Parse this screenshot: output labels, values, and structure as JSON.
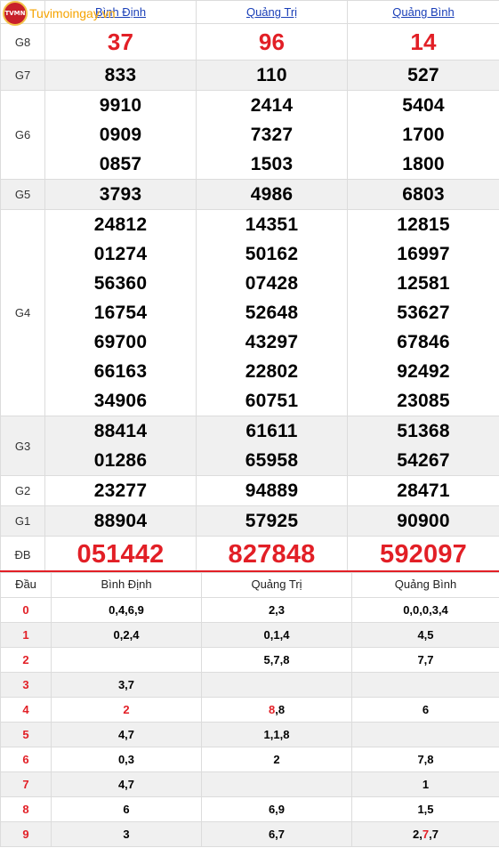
{
  "logo": {
    "text": "Tuvimoingay.vn",
    "badge": "TVMN"
  },
  "provinces": [
    "Bình Định",
    "Quảng Trị",
    "Quảng Bình"
  ],
  "prizes": [
    {
      "label": "G8",
      "values": [
        [
          "37"
        ],
        [
          "96"
        ],
        [
          "14"
        ]
      ]
    },
    {
      "label": "G7",
      "values": [
        [
          "833"
        ],
        [
          "110"
        ],
        [
          "527"
        ]
      ]
    },
    {
      "label": "G6",
      "values": [
        [
          "9910",
          "0909",
          "0857"
        ],
        [
          "2414",
          "7327",
          "1503"
        ],
        [
          "5404",
          "1700",
          "1800"
        ]
      ]
    },
    {
      "label": "G5",
      "values": [
        [
          "3793"
        ],
        [
          "4986"
        ],
        [
          "6803"
        ]
      ]
    },
    {
      "label": "G4",
      "values": [
        [
          "24812",
          "01274",
          "56360",
          "16754",
          "69700",
          "66163",
          "34906"
        ],
        [
          "14351",
          "50162",
          "07428",
          "52648",
          "43297",
          "22802",
          "60751"
        ],
        [
          "12815",
          "16997",
          "12581",
          "53627",
          "67846",
          "92492",
          "23085"
        ]
      ]
    },
    {
      "label": "G3",
      "values": [
        [
          "88414",
          "01286"
        ],
        [
          "61611",
          "65958"
        ],
        [
          "51368",
          "54267"
        ]
      ]
    },
    {
      "label": "G2",
      "values": [
        [
          "23277"
        ],
        [
          "94889"
        ],
        [
          "28471"
        ]
      ]
    },
    {
      "label": "G1",
      "values": [
        [
          "88904"
        ],
        [
          "57925"
        ],
        [
          "90900"
        ]
      ]
    },
    {
      "label": "ĐB",
      "values": [
        [
          "051442"
        ],
        [
          "827848"
        ],
        [
          "592097"
        ]
      ]
    }
  ],
  "loto": {
    "header": "Đầu",
    "rows": [
      {
        "head": "0",
        "tails": [
          "0,4,6,9",
          "2,3",
          "0,0,0,3,4"
        ]
      },
      {
        "head": "1",
        "tails": [
          "0,2,4",
          "0,1,4",
          "4,5"
        ]
      },
      {
        "head": "2",
        "tails": [
          "",
          "5,7,8",
          "7,7"
        ]
      },
      {
        "head": "3",
        "tails": [
          "3,7",
          "",
          ""
        ]
      },
      {
        "head": "4",
        "tails": [
          "2",
          "8,8",
          "6"
        ]
      },
      {
        "head": "5",
        "tails": [
          "4,7",
          "1,1,8",
          ""
        ]
      },
      {
        "head": "6",
        "tails": [
          "0,3",
          "2",
          "7,8"
        ]
      },
      {
        "head": "7",
        "tails": [
          "4,7",
          "",
          "1"
        ]
      },
      {
        "head": "8",
        "tails": [
          "6",
          "6,9",
          "1,5"
        ]
      },
      {
        "head": "9",
        "tails": [
          "3",
          "6,7",
          "2,7,7"
        ]
      }
    ]
  },
  "colors": {
    "accent_red": "#e21f26",
    "link_blue": "#1a3fb8",
    "row_alt": "#f0f0f0"
  }
}
